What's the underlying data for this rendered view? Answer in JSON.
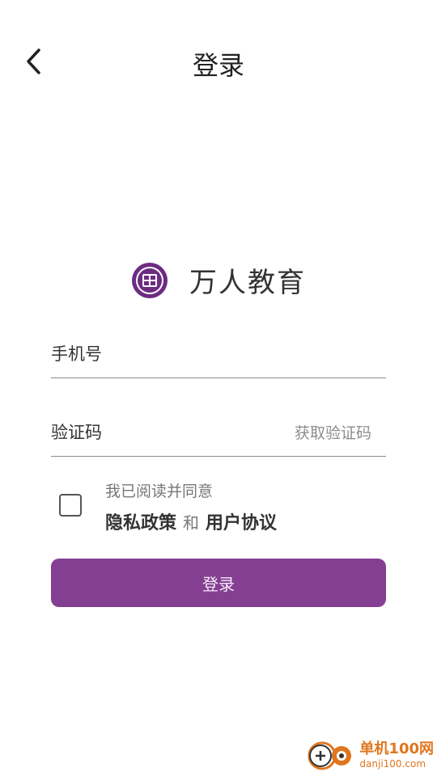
{
  "header": {
    "title": "登录",
    "back_icon": "chevron-left-icon"
  },
  "brand": {
    "name": "万人教育",
    "logo_icon": "brand-seal-icon",
    "logo_color": "#6b2c82"
  },
  "form": {
    "phone_placeholder": "手机号",
    "code_placeholder": "验证码",
    "get_code_label": "获取验证码",
    "agreement": {
      "prefix": "我已阅读并同意",
      "privacy_label": "隐私政策",
      "conjunction": "和",
      "terms_label": "用户协议",
      "checked": false
    },
    "submit_label": "登录"
  },
  "watermark": {
    "name": "单机100网",
    "url": "danji100.com"
  },
  "colors": {
    "accent": "#843f92",
    "divider": "#8a8a8a",
    "watermark": "#e0761e"
  }
}
